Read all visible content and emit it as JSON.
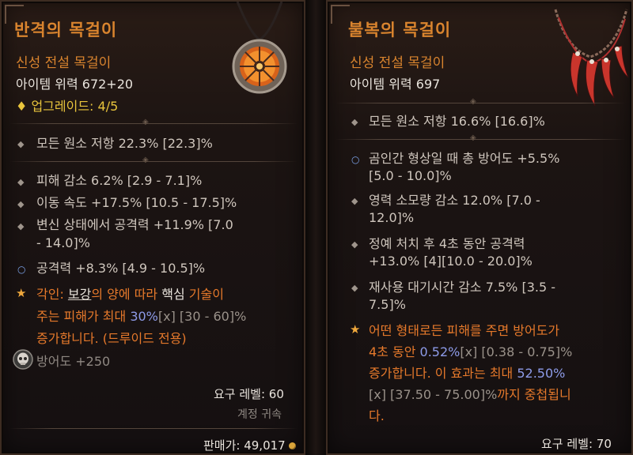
{
  "left": {
    "title": "반격의 목걸이",
    "subtitle": "신성 전설 목걸이",
    "power_label": "아이템 위력 672+20",
    "upgrade_label": "업그레이드: 4/5",
    "implicit": "모든 원소 저항 22.3% [22.3]%",
    "stats": [
      "피해 감소 6.2% [2.9 - 7.1]%",
      "이동 속도 +17.5% [10.5 - 17.5]%",
      "변신 상태에서 공격력 +11.9% [7.0",
      "- 14.0]%",
      "공격력 +8.3% [4.9 - 10.5]%"
    ],
    "aspect": {
      "l1_a": "각인: ",
      "l1_b": "보강",
      "l1_c": "의 양에 따라 ",
      "l1_d": "핵심",
      "l1_e": " 기술이",
      "l2_a": "주는 피해가 최대 ",
      "l2_b": "30%",
      "l2_c": "[x] [30 - 60]%",
      "l3": "증가합니다. (드루이드 전용)"
    },
    "armor": "방어도 +250",
    "req_level": "요구 레벨: 60",
    "bound": "계정 귀속",
    "sell": "판매가: 49,017"
  },
  "right": {
    "title": "불복의 목걸이",
    "subtitle": "신성 전설 목걸이",
    "power_label": "아이템 위력 697",
    "implicit": "모든 원소 저항 16.6% [16.6]%",
    "stats": [
      "곰인간 형상일 때 총 방어도 +5.5%",
      "[5.0 - 10.0]%",
      "영력 소모량 감소 12.0% [7.0 -",
      "12.0]%",
      "정예 처치 후 4초 동안 공격력",
      "+13.0% [4][10.0 - 20.0]%",
      "재사용 대기시간 감소 7.5% [3.5 -",
      "7.5]%"
    ],
    "aspect": {
      "l1": "어떤 형태로든 피해를 주면 방어도가",
      "l2_a": "4초 동안 ",
      "l2_b": "0.52%",
      "l2_c": "[x] [0.38 - 0.75]%",
      "l3_a": "증가합니다. 이 효과는 최대 ",
      "l3_b": "52.50%",
      "l4_a": "[x] [37.50 - 75.00]%",
      "l4_b": "까지 중첩됩니",
      "l5": "다."
    },
    "req_level": "요구 레벨: 70"
  },
  "icons": [
    "pendant-amulet-icon",
    "claw-necklace-icon",
    "skull-armor-icon",
    "diamond-bullet-icon",
    "star-bullet-icon",
    "gold-coin-icon"
  ],
  "colors": {
    "title": "#d9842e",
    "gold": "#e8c43c",
    "blue": "#8d9be8",
    "stat": "#cfc6bd"
  }
}
